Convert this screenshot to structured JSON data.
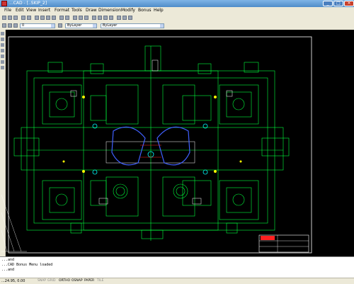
{
  "window": {
    "title": "...CAD - [..SKIP_2]"
  },
  "menu": {
    "items": [
      "File",
      "Edit",
      "View",
      "Insert",
      "Format",
      "Tools",
      "Draw",
      "Dimension",
      "Modify",
      "Bonus",
      "Help"
    ]
  },
  "layer_toolbar": {
    "layer_value": "0",
    "color_value": "ByLayer",
    "linetype_value": "ByLayer"
  },
  "command_lines": [
    "...and",
    "...CAD Bonus Menu loaded",
    "...and"
  ],
  "status": {
    "coords": "...24.95, 0.00",
    "buttons": [
      "SNAP",
      "GRID",
      "ORTHO",
      "OSNAP",
      "PAPER",
      "TILE"
    ]
  },
  "title_block": {
    "text": "..."
  },
  "colors": {
    "green": "#00ff3c",
    "white": "#ffffff",
    "yellow": "#ffff00",
    "cyan": "#00ffff",
    "blue": "#4060ff",
    "red": "#ff2020"
  }
}
